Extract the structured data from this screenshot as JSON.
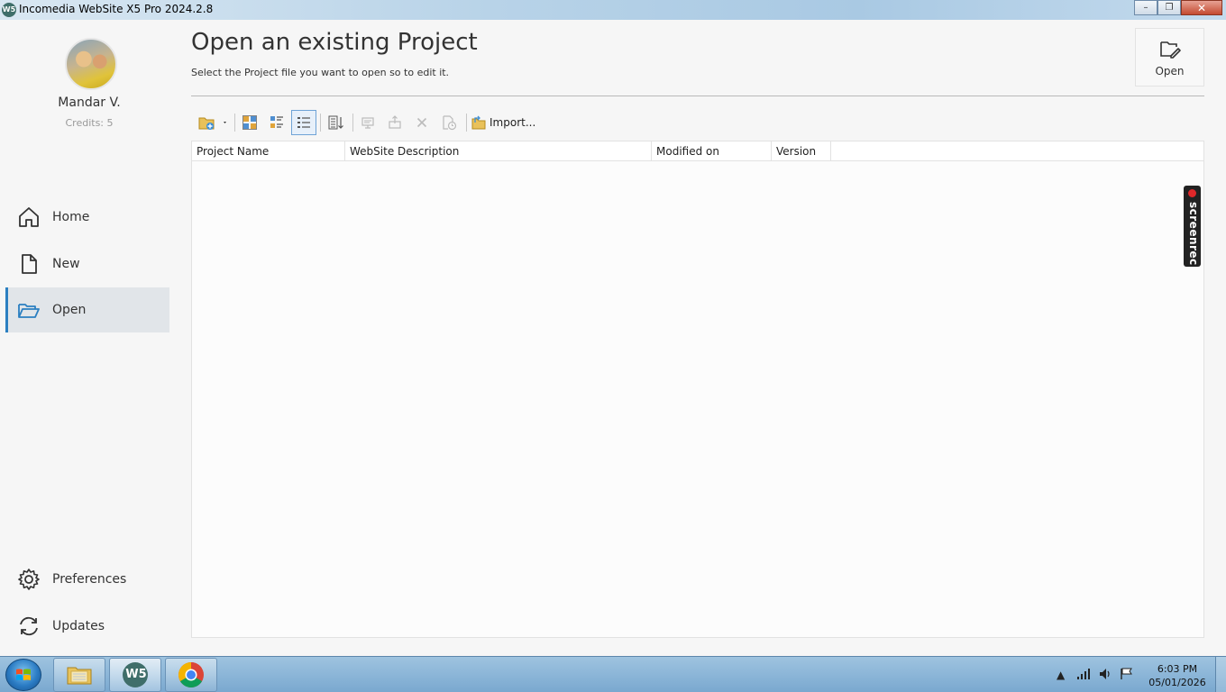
{
  "window": {
    "title": "Incomedia WebSite X5 Pro 2024.2.8",
    "icon_text": "W5",
    "minimize": "–",
    "maximize": "❐",
    "close": "✕"
  },
  "user": {
    "name": "Mandar V.",
    "credits": "Credits: 5"
  },
  "nav": {
    "items": [
      {
        "label": "Home",
        "icon": "home-icon"
      },
      {
        "label": "New",
        "icon": "new-file-icon"
      },
      {
        "label": "Open",
        "icon": "folder-open-icon",
        "active": true
      }
    ],
    "bottom_items": [
      {
        "label": "Preferences",
        "icon": "gear-icon"
      },
      {
        "label": "Updates",
        "icon": "refresh-icon"
      }
    ]
  },
  "page": {
    "title": "Open an existing Project",
    "subtitle": "Select the Project file you want to open so to edit it.",
    "open_button": "Open"
  },
  "toolbar": {
    "import_label": "Import..."
  },
  "grid": {
    "columns": [
      "Project Name",
      "WebSite Description",
      "Modified on",
      "Version"
    ],
    "rows": []
  },
  "overlay": {
    "screenrec": "screenrec"
  },
  "taskbar": {
    "time": "6:03 PM",
    "date": "05/01/2026",
    "apps": [
      "explorer-icon",
      "websitex5-icon",
      "chrome-icon"
    ],
    "app_badge": "W5"
  },
  "colors": {
    "accent": "#2b7fc1",
    "active_nav_bg": "#e1e5e9"
  }
}
